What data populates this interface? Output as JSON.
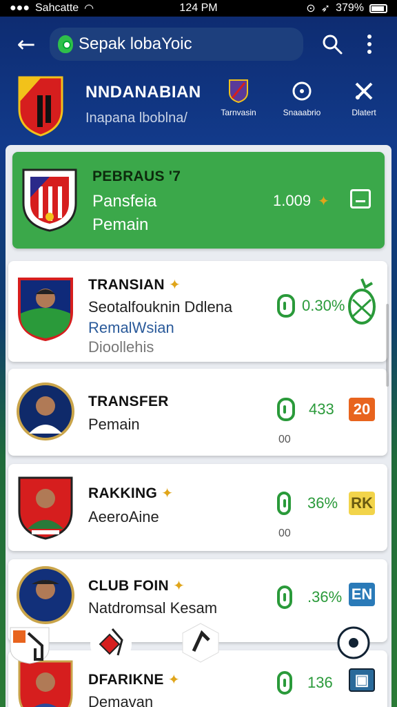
{
  "status": {
    "carrier": "Sahcatte",
    "time": "124 PM",
    "battery": "379%"
  },
  "appbar": {
    "search_text": "Sepak lobaYoic"
  },
  "league": {
    "name": "NNDANABIAN",
    "subtitle": "Inapana lboblna/",
    "actions": [
      {
        "label": "Tarnvasin",
        "icon": "shield-icon"
      },
      {
        "label": "Snaaabrio",
        "icon": "target-icon"
      },
      {
        "label": "Dlatert",
        "icon": "tools-icon"
      }
    ]
  },
  "cards": [
    {
      "title": "PEBRAUS '7",
      "line1": "Pansfeia",
      "line2": "Pemain",
      "value": "1.009",
      "highlight": true
    },
    {
      "title": "TRANSIAN",
      "line1": "Seotalfouknin Ddlena",
      "line2": "RemalWsian",
      "line3": "Dioollehis",
      "value": "0.30%"
    },
    {
      "title": "TRANSFER",
      "line1": "Pemain",
      "value": "433",
      "sub": "00",
      "badge": "20"
    },
    {
      "title": "RAKKING",
      "line1": "AeeroAine",
      "value": "36%",
      "sub": "00",
      "badge": "RK"
    },
    {
      "title": "CLUB FOIN",
      "line1": "Natdromsal Kesam",
      "value": ".36%",
      "badge": "EN"
    },
    {
      "title": "DFARIKNE",
      "line1": "Demavan",
      "value": "136"
    }
  ],
  "colors": {
    "accent_green": "#3ba84a",
    "stat_green": "#2a9a3a",
    "nav_blue": "#0d2a6e",
    "badge_orange": "#e8641e",
    "badge_yellow": "#f2d44a",
    "badge_blue": "#2a7ab8"
  }
}
